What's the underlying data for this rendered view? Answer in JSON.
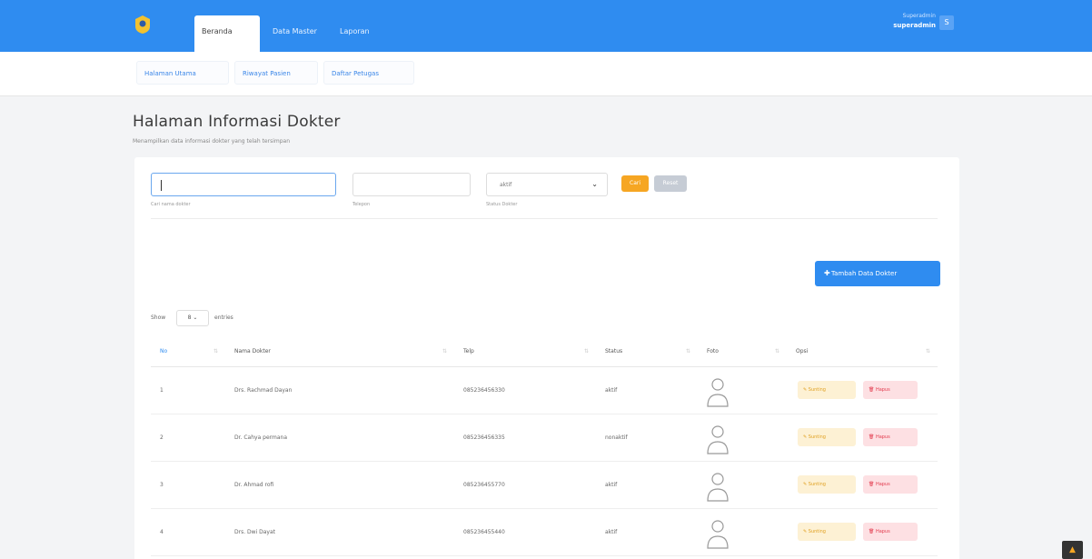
{
  "header": {
    "tabs": [
      "Beranda",
      "Data Master",
      "Laporan"
    ],
    "user_role": "Superadmin",
    "user_name": "superadmin",
    "avatar_initial": "S"
  },
  "subnav": [
    "Halaman Utama",
    "Riwayat Pasien",
    "Daftar Petugas"
  ],
  "page": {
    "title": "Halaman Informasi Dokter",
    "subtitle": "Menampilkan data informasi dokter yang telah tersimpan"
  },
  "filters": {
    "search_value": "",
    "search_hint": "Cari nama dokter",
    "phone_value": "",
    "phone_hint": "Telepon",
    "status_value": "aktif",
    "status_hint": "Status Dokter",
    "cari_label": "Cari",
    "reset_label": "Reset"
  },
  "add_button_label": "Tambah Data Dokter",
  "table": {
    "show_label": "Show",
    "entries_value": "8",
    "entries_label": "entries",
    "columns": [
      "No",
      "Nama Dokter",
      "Telp",
      "Status",
      "Foto",
      "Opsi"
    ],
    "rows": [
      {
        "no": "1",
        "nama": "Drs. Rachmad Dayan",
        "telp": "085236456330",
        "status": "aktif"
      },
      {
        "no": "2",
        "nama": "Dr. Cahya permana",
        "telp": "085236456335",
        "status": "nonaktif"
      },
      {
        "no": "3",
        "nama": "Dr. Ahmad rofi",
        "telp": "085236455770",
        "status": "aktif"
      },
      {
        "no": "4",
        "nama": "Drs. Dwi Dayat",
        "telp": "085236455440",
        "status": "aktif"
      }
    ],
    "edit_label": "Sunting",
    "delete_label": "Hapus"
  },
  "colors": {
    "primary": "#2f8cf0",
    "warning": "#f6a623",
    "danger": "#e23a4d"
  }
}
